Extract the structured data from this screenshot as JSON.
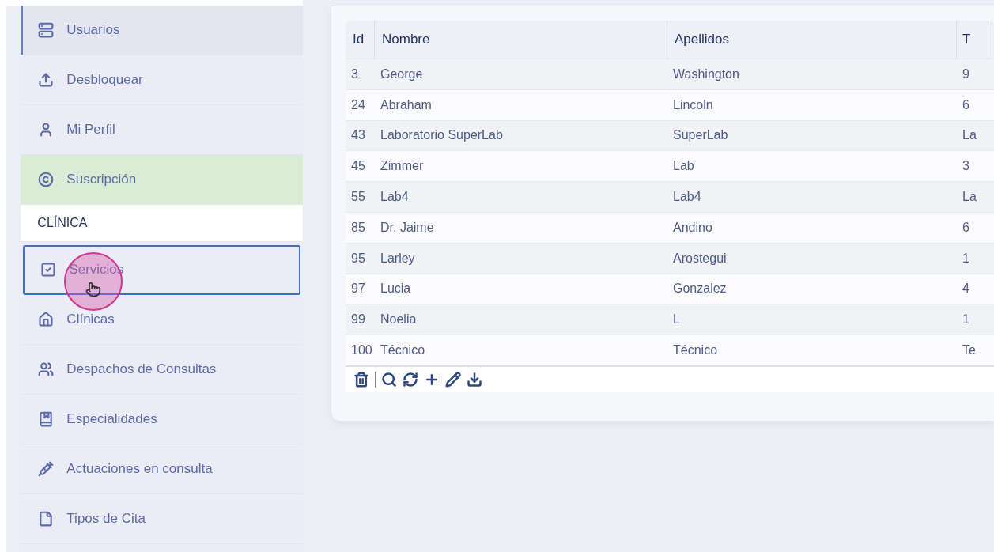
{
  "sidebar": {
    "items": [
      {
        "kind": "item",
        "label": "Usuarios",
        "current": true,
        "highlighted": false,
        "selected": false
      },
      {
        "kind": "item",
        "label": "Desbloquear",
        "current": false,
        "highlighted": false,
        "selected": false
      },
      {
        "kind": "item",
        "label": "Mi Perfil",
        "current": false,
        "highlighted": false,
        "selected": false
      },
      {
        "kind": "item",
        "label": "Suscripción",
        "current": false,
        "highlighted": true,
        "selected": false
      },
      {
        "kind": "section",
        "label": "CLÍNICA"
      },
      {
        "kind": "item",
        "label": "Servicios",
        "current": false,
        "highlighted": false,
        "selected": true
      },
      {
        "kind": "item",
        "label": "Clínicas",
        "current": false,
        "highlighted": false,
        "selected": false
      },
      {
        "kind": "item",
        "label": "Despachos de Consultas",
        "current": false,
        "highlighted": false,
        "selected": false
      },
      {
        "kind": "item",
        "label": "Especialidades",
        "current": false,
        "highlighted": false,
        "selected": false
      },
      {
        "kind": "item",
        "label": "Actuaciones en consulta",
        "current": false,
        "highlighted": false,
        "selected": false
      },
      {
        "kind": "item",
        "label": "Tipos de Cita",
        "current": false,
        "highlighted": false,
        "selected": false
      }
    ]
  },
  "table": {
    "columns": [
      "Id",
      "Nombre",
      "Apellidos",
      "T"
    ],
    "rows": [
      [
        "3",
        "George",
        "Washington",
        "9"
      ],
      [
        "24",
        "Abraham",
        "Lincoln",
        "6"
      ],
      [
        "43",
        "Laboratorio SuperLab",
        "SuperLab",
        "La"
      ],
      [
        "45",
        "Zimmer",
        "Lab",
        "3"
      ],
      [
        "55",
        "Lab4",
        "Lab4",
        "La"
      ],
      [
        "85",
        "Dr. Jaime",
        "Andino",
        "6"
      ],
      [
        "95",
        "Larley",
        "Arostegui",
        "1"
      ],
      [
        "97",
        "Lucia",
        "Gonzalez",
        "4"
      ],
      [
        "99",
        "Noelia",
        "L",
        "1"
      ],
      [
        "100",
        "Técnico",
        "Técnico",
        "Te"
      ]
    ]
  }
}
